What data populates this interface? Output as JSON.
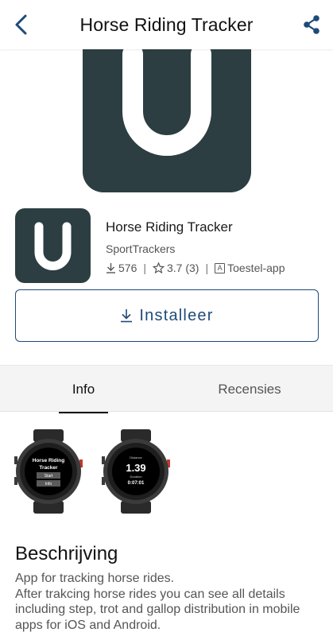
{
  "header": {
    "title": "Horse Riding Tracker",
    "back_icon": "chevron-left-icon",
    "share_icon": "share-icon"
  },
  "app": {
    "name": "Horse Riding Tracker",
    "developer": "SportTrackers",
    "downloads": "576",
    "rating": "3.7 (3)",
    "device_type": "Toestel-app",
    "device_badge": "A"
  },
  "install": {
    "label": "Installeer"
  },
  "tabs": [
    {
      "label": "Info",
      "active": true
    },
    {
      "label": "Recensies",
      "active": false
    }
  ],
  "screenshots": [
    {
      "line1": "Horse Riding",
      "line2": "Tracker",
      "button1": "Start",
      "button2": "Info"
    },
    {
      "label_top": "Distance",
      "value": "1.39",
      "label_mid": "Duration",
      "time": "0:07:01"
    }
  ],
  "description": {
    "title": "Beschrijving",
    "text": "App for tracking horse rides.\nAfter trakcing horse rides you can see all details including step, trot and gallop distribution in mobile apps for iOS and Android."
  },
  "colors": {
    "accent": "#1e4a7a",
    "icon_bg": "#2c3e42"
  }
}
